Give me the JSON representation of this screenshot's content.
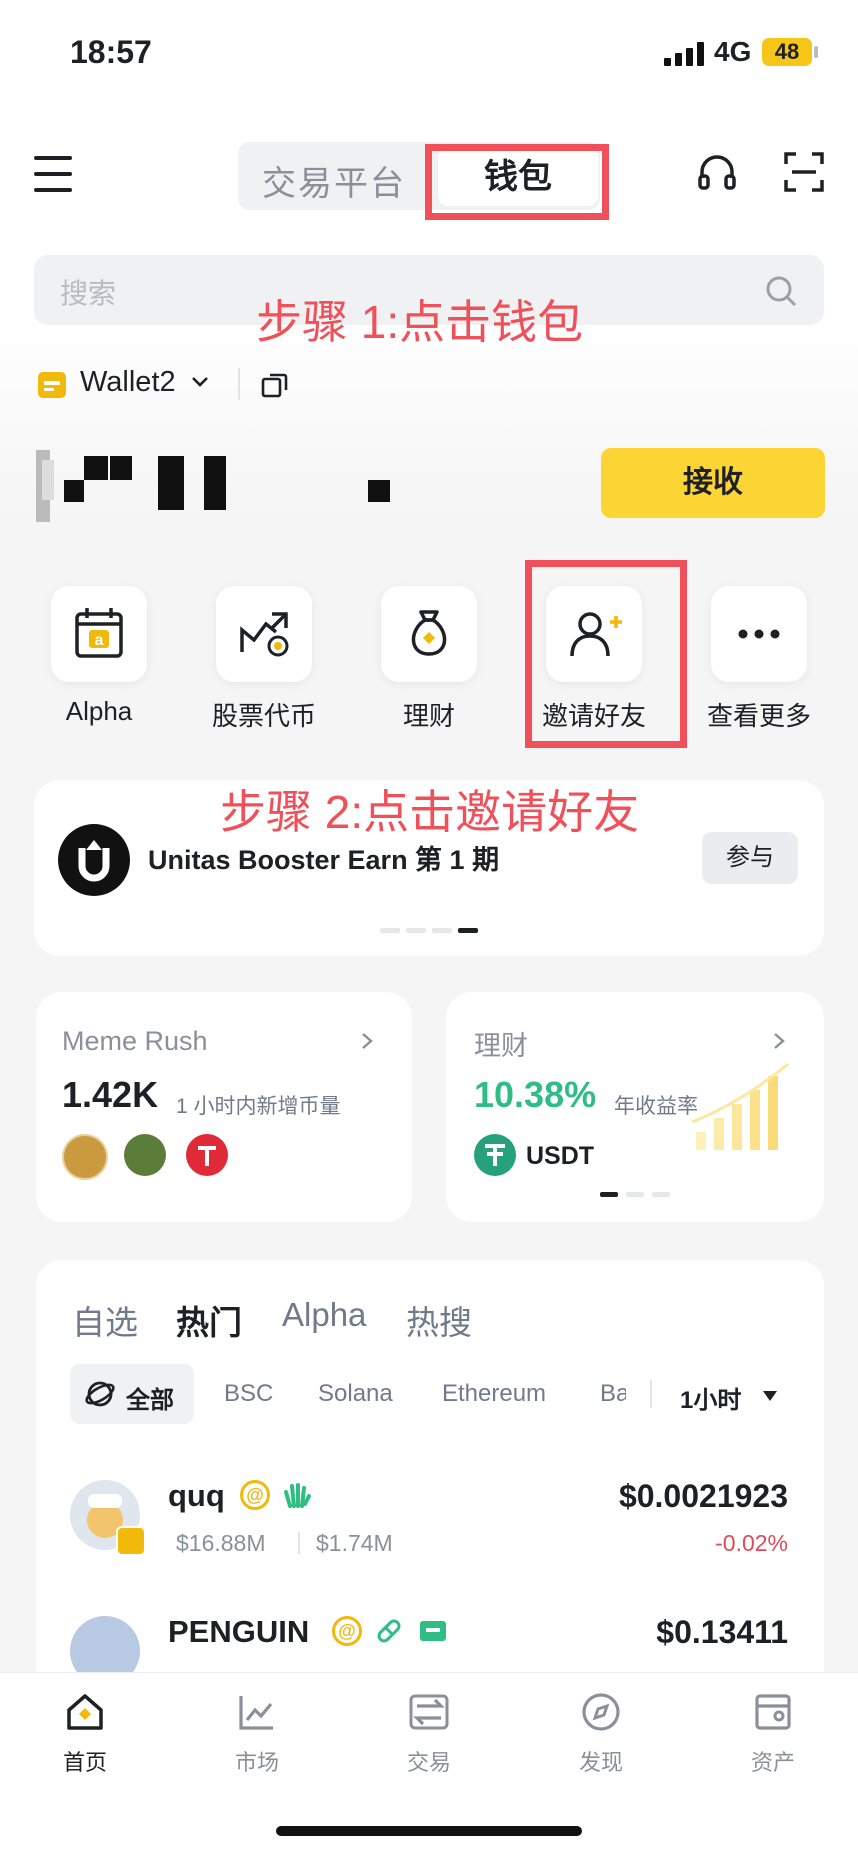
{
  "status_bar": {
    "time": "18:57",
    "network": "4G",
    "battery": "48"
  },
  "header": {
    "tab_exchange": "交易平台",
    "tab_wallet": "钱包"
  },
  "search": {
    "placeholder": "搜索"
  },
  "annotations": {
    "step1": "步骤 1:点击钱包",
    "step2": "步骤 2:点击邀请好友"
  },
  "wallet": {
    "name": "Wallet2",
    "receive_label": "接收"
  },
  "quick_actions": [
    {
      "label": "Alpha",
      "icon": "alpha-calendar-icon"
    },
    {
      "label": "股票代币",
      "icon": "stock-token-icon"
    },
    {
      "label": "理财",
      "icon": "money-bag-icon"
    },
    {
      "label": "邀请好友",
      "icon": "invite-friend-icon"
    },
    {
      "label": "查看更多",
      "icon": "more-icon"
    }
  ],
  "banner": {
    "title": "Unitas Booster Earn 第 1 期",
    "button": "参与",
    "page_index": 4,
    "page_count": 4
  },
  "meme_card": {
    "title": "Meme Rush",
    "value": "1.42K",
    "caption": "1 小时内新增币量"
  },
  "earn_card": {
    "title": "理财",
    "rate": "10.38%",
    "caption": "年收益率",
    "asset": "USDT"
  },
  "market": {
    "tabs": [
      "自选",
      "热门",
      "Alpha",
      "热搜"
    ],
    "active_tab": "热门",
    "chains": [
      "全部",
      "BSC",
      "Solana",
      "Ethereum",
      "Ba"
    ],
    "timeframe": "1小时",
    "rows": [
      {
        "name": "quq",
        "market_cap": "$16.88M",
        "volume": "$1.74M",
        "price": "$0.0021923",
        "change": "-0.02%"
      },
      {
        "name": "PENGUIN",
        "price": "$0.13411"
      }
    ]
  },
  "bottom_nav": [
    {
      "label": "首页",
      "icon": "home-icon",
      "active": true
    },
    {
      "label": "市场",
      "icon": "chart-icon"
    },
    {
      "label": "交易",
      "icon": "trade-icon"
    },
    {
      "label": "发现",
      "icon": "discover-icon"
    },
    {
      "label": "资产",
      "icon": "assets-icon"
    }
  ],
  "colors": {
    "brand_yellow": "#fcd535",
    "annotation_red": "#f0505a",
    "positive_green": "#2ebd85",
    "negative_red": "#e04a59"
  }
}
